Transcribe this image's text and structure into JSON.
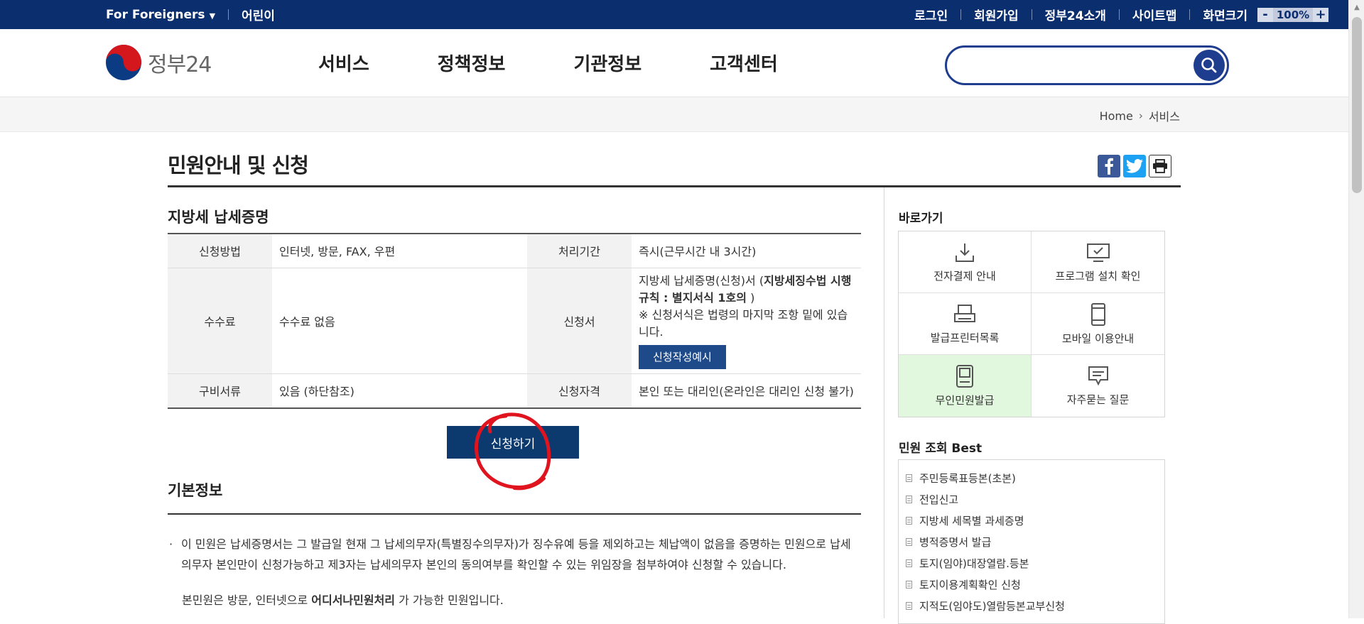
{
  "topbar": {
    "foreigners": "For Foreigners",
    "kids": "어린이",
    "login": "로그인",
    "signup": "회원가입",
    "about": "정부24소개",
    "sitemap": "사이트맵",
    "screen_size": "화면크기",
    "zoom_minus": "-",
    "zoom_value": "100%",
    "zoom_plus": "+"
  },
  "header": {
    "logo_text": "정부24",
    "menu": [
      "서비스",
      "정책정보",
      "기관정보",
      "고객센터"
    ],
    "search_placeholder": ""
  },
  "breadcrumb": {
    "home": "Home",
    "current": "서비스"
  },
  "page": {
    "title": "민원안내 및 신청",
    "subtitle": "지방세 납세증명"
  },
  "info_table": {
    "method_label": "신청방법",
    "method_value": "인터넷, 방문, FAX, 우편",
    "period_label": "처리기간",
    "period_value": "즉시(근무시간 내 3시간)",
    "fee_label": "수수료",
    "fee_value": "수수료 없음",
    "form_label": "신청서",
    "form_value_1": "지방세 납세증명(신청)서 (",
    "form_value_bold": "지방세징수법 시행규칙 : 별지서식 1호의",
    "form_value_2": " )",
    "form_note": "※ 신청서식은 법령의 마지막 조항 밑에 있습니다.",
    "form_sample_button": "신청작성예시",
    "docs_label": "구비서류",
    "docs_value": "있음 (하단참조)",
    "qual_label": "신청자격",
    "qual_value": "본인 또는 대리인(온라인은 대리인 신청 불가)"
  },
  "apply_button": "신청하기",
  "basic_info": {
    "title": "기본정보",
    "bullet": "·",
    "para1": "이 민원은 납세증명서는 그 발급일 현재 그 납세의무자(특별징수의무자)가 징수유예 등을 제외하고는 체납액이 없음을 증명하는 민원으로 납세의무자 본인만이 신청가능하고 제3자는 납세의무자 본인의 동의여부를 확인할 수 있는 위임장을 첨부하여야 신청할 수 있습니다.",
    "para2_a": "본민원은 방문, 인터넷으로 ",
    "para2_bold": "어디서나민원처리",
    "para2_b": " 가 가능한 민원입니다."
  },
  "sidebar": {
    "quick_title": "바로가기",
    "quick_links": [
      {
        "label": "전자결제 안내",
        "icon": "download-icon"
      },
      {
        "label": "프로그램 설치 확인",
        "icon": "monitor-check-icon"
      },
      {
        "label": "발급프린터목록",
        "icon": "printer-icon"
      },
      {
        "label": "모바일 이용안내",
        "icon": "mobile-icon"
      },
      {
        "label": "무인민원발급",
        "icon": "kiosk-icon"
      },
      {
        "label": "자주묻는 질문",
        "icon": "speech-bubble-icon"
      }
    ],
    "best_title": "민원 조회 Best",
    "best_items": [
      "주민등록표등본(초본)",
      "전입신고",
      "지방세 세목별 과세증명",
      "병적증명서 발급",
      "토지(임야)대장열람.등본",
      "토지이용계획확인 신청",
      "지적도(임야도)열람등본교부신청"
    ]
  },
  "colors": {
    "topbar": "#0b2e6f",
    "search_border": "#1e3d8f",
    "apply_button": "#0c3a6e",
    "highlight_green": "#e2f8de",
    "annotation_red": "#e0141e"
  }
}
